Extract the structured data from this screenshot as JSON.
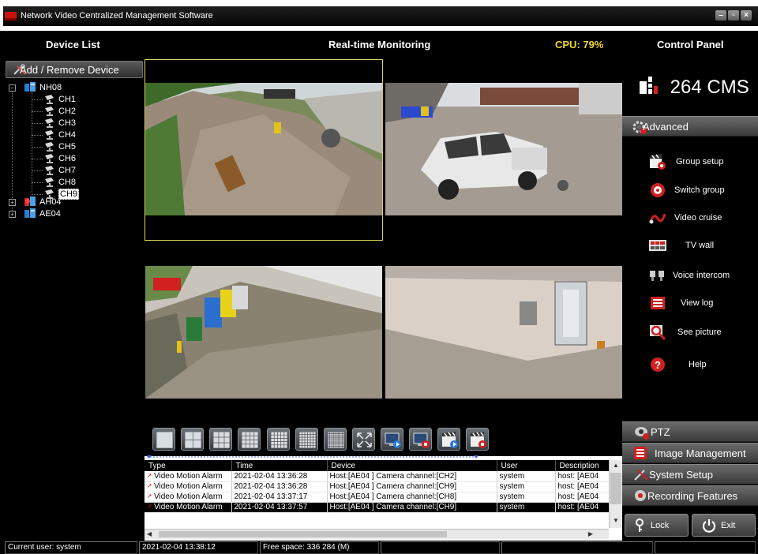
{
  "window": {
    "title": "Network Video Centralized Management Software",
    "controls": [
      "minimize-icon",
      "restore-icon",
      "close-icon"
    ]
  },
  "header": {
    "device_list": "Device List",
    "realtime": "Real-time Monitoring",
    "cpu": "CPU: 79%",
    "control_panel": "Control Panel"
  },
  "left": {
    "add_remove": "Add / Remove Device",
    "tree": {
      "devices": [
        {
          "name": "NH08",
          "expanded": true,
          "channels": [
            "CH1",
            "CH2",
            "CH3",
            "CH4",
            "CH5",
            "CH6",
            "CH7",
            "CH8",
            "CH9"
          ],
          "selected_channel": "CH9"
        },
        {
          "name": "AH04",
          "expanded": false
        },
        {
          "name": "AE04",
          "expanded": false
        }
      ]
    }
  },
  "video": {
    "layout": "2x2",
    "selected_pane": 1
  },
  "toolbar": {
    "buttons": [
      "layout-1-icon",
      "layout-4-icon",
      "layout-9-icon",
      "layout-16-icon",
      "layout-25-icon",
      "layout-36-icon",
      "layout-64-icon",
      "fullscreen-icon",
      "start-all-video-icon",
      "stop-all-video-icon",
      "record-all-icon",
      "stop-record-all-icon"
    ]
  },
  "log": {
    "columns": [
      "Type",
      "Time",
      "Device",
      "User",
      "Description"
    ],
    "rows": [
      {
        "type": "Video Motion Alarm",
        "time": "2021-02-04 13:36:28",
        "device": "Host:[AE04 ] Camera channel:[CH2]",
        "user": "system",
        "desc": "host: [AE04"
      },
      {
        "type": "Video Motion Alarm",
        "time": "2021-02-04 13:36:28",
        "device": "Host:[AE04 ] Camera channel:[CH9]",
        "user": "system",
        "desc": "host: [AE04"
      },
      {
        "type": "Video Motion Alarm",
        "time": "2021-02-04 13:37:17",
        "device": "Host:[AE04 ] Camera channel:[CH8]",
        "user": "system",
        "desc": "host: [AE04"
      },
      {
        "type": "Video Motion Alarm",
        "time": "2021-02-04 13:37:57",
        "device": "Host:[AE04 ] Camera channel:[CH9]",
        "user": "system",
        "desc": "host: [AE04"
      }
    ]
  },
  "right": {
    "logo": "264 CMS",
    "advanced": "Advanced",
    "advanced_items": [
      {
        "label": "Group setup",
        "icon": "clapper-gear-icon"
      },
      {
        "label": "Switch group",
        "icon": "switch-group-icon"
      },
      {
        "label": "Video cruise",
        "icon": "cruise-icon"
      },
      {
        "label": "TV wall",
        "icon": "tv-wall-icon"
      },
      {
        "label": "Voice intercom",
        "icon": "intercom-icon"
      },
      {
        "label": "View log",
        "icon": "log-icon"
      },
      {
        "label": "See picture",
        "icon": "magnifier-icon"
      },
      {
        "label": "Help",
        "icon": "help-icon"
      }
    ],
    "ptz": "PTZ",
    "image_management": "Image Management",
    "system_setup": "System Setup",
    "recording_features": "Recording Features",
    "lock": "Lock",
    "exit": "Exit"
  },
  "status": {
    "user": "Current user: system",
    "datetime": "2021-02-04 13:38:12",
    "free_space": "Free space: 336 284 (M)"
  },
  "colors": {
    "cpu": "#f2d62a",
    "selection": "#d8cf5a",
    "alarm": "#d01010"
  }
}
